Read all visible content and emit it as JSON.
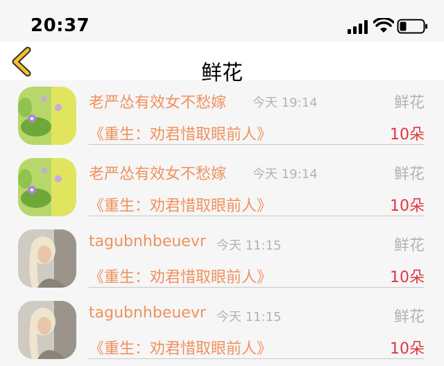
{
  "status_bar": {
    "time": "20:37"
  },
  "nav": {
    "title": "鲜花"
  },
  "rows": [
    {
      "name": "老严怂有效女不愁嫁",
      "time": "今天 19:14",
      "gift": "鲜花",
      "book": "《重生：劝君惜取眼前人》",
      "count": "10朵",
      "avatar": "flower"
    },
    {
      "name": "老严怂有效女不愁嫁",
      "time": "今天 19:14",
      "gift": "鲜花",
      "book": "《重生：劝君惜取眼前人》",
      "count": "10朵",
      "avatar": "flower"
    },
    {
      "name": "tagubnhbeuevr",
      "time": "今天 11:15",
      "gift": "鲜花",
      "book": "《重生：劝君惜取眼前人》",
      "count": "10朵",
      "avatar": "person"
    },
    {
      "name": "tagubnhbeuevr",
      "time": "今天 11:15",
      "gift": "鲜花",
      "book": "《重生：劝君惜取眼前人》",
      "count": "10朵",
      "avatar": "person"
    }
  ],
  "colors": {
    "accent": "#f0915d",
    "count": "#e3353f",
    "muted": "#b3b3b3",
    "back_icon": "#f3c12d"
  }
}
